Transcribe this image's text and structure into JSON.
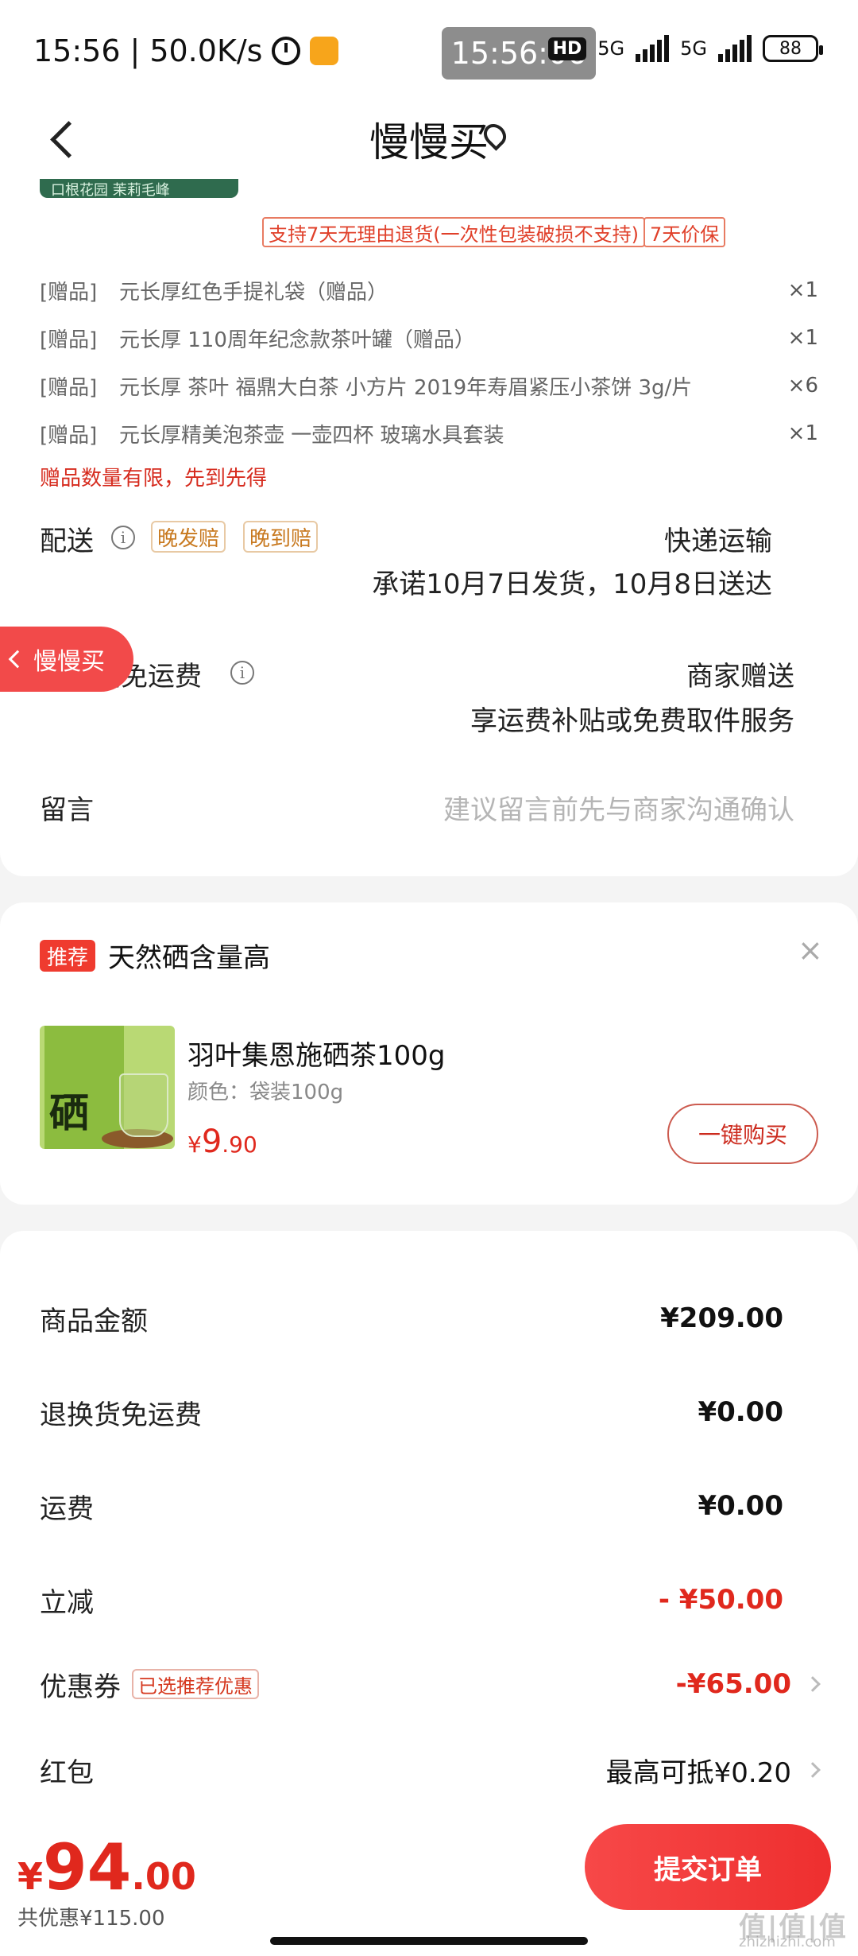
{
  "status_bar": {
    "time": "15:56",
    "speed": "50.0K/s",
    "center_clock": "15:56:06",
    "hd_label": "HD",
    "network_1": "5G",
    "network_2": "5G",
    "battery": "88"
  },
  "header": {
    "title": "慢慢买"
  },
  "order_card": {
    "promo_strip_text": "口根花园 茉莉毛峰",
    "tags": [
      "支持7天无理由退货(一次性包装破损不支持)",
      "7天价保"
    ],
    "gifts": [
      {
        "tag": "[赠品]",
        "name": "元长厚红色手提礼袋（赠品）",
        "qty": "×1"
      },
      {
        "tag": "[赠品]",
        "name": "元长厚 110周年纪念款茶叶罐（赠品）",
        "qty": "×1"
      },
      {
        "tag": "[赠品]",
        "name": "元长厚 茶叶 福鼎大白茶 小方片 2019年寿眉紧压小茶饼 3g/片",
        "qty": "×6"
      },
      {
        "tag": "[赠品]",
        "name": "元长厚精美泡茶壶 一壶四杯 玻璃水具套装",
        "qty": "×1"
      }
    ],
    "gift_warning": "赠品数量有限，先到先得",
    "delivery": {
      "label": "配送",
      "badge_late_ship": "晚发赔",
      "badge_late_arrive": "晚到赔",
      "method": "快递运输",
      "promise": "承诺10月7日发货，10月8日送达"
    },
    "return_shipping": {
      "label": "退换货免运费",
      "value": "商家赠送",
      "sub": "享运费补贴或免费取件服务"
    },
    "message": {
      "label": "留言",
      "placeholder": "建议留言前先与商家沟通确认"
    }
  },
  "float_back": {
    "label": "慢慢买"
  },
  "recommend": {
    "badge": "推荐",
    "title": "天然硒含量高",
    "close_icon": "×",
    "product": {
      "image_text": "硒",
      "name": "羽叶集恩施硒茶100g",
      "spec": "颜色：袋装100g",
      "price_symbol": "¥",
      "price_int": "9",
      "price_dec": ".90",
      "buy_label": "一键购买"
    }
  },
  "summary": {
    "rows": [
      {
        "label": "商品金额",
        "value": "¥209.00"
      },
      {
        "label": "退换货免运费",
        "value": "¥0.00"
      },
      {
        "label": "运费",
        "value": "¥0.00"
      },
      {
        "label": "立减",
        "value": "- ¥50.00"
      },
      {
        "label": "优惠券",
        "tag": "已选推荐优惠",
        "value": "-¥65.00"
      },
      {
        "label": "红包",
        "value": "最高可抵¥0.20"
      }
    ]
  },
  "bottom": {
    "total_symbol": "¥",
    "total_int": "94",
    "total_dec": ".00",
    "saved": "共优惠¥115.00",
    "submit_label": "提交订单",
    "watermark": "值|值|值",
    "watermark_sub": "zhizhizhi.com"
  },
  "colors": {
    "accent_red": "#e0281d",
    "button_red": "#f24a4a",
    "badge_orange": "#c8791f"
  }
}
